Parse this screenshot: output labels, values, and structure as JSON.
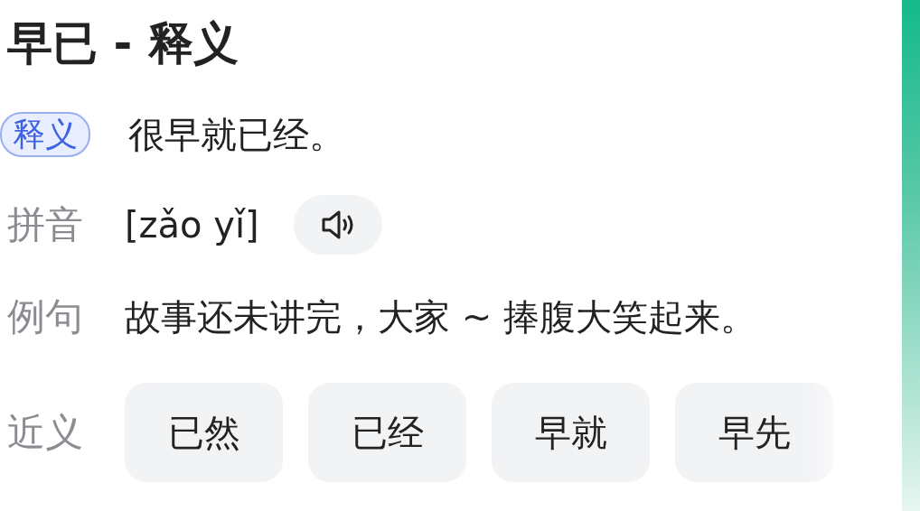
{
  "title": "早已 - 释义",
  "rows": [
    {
      "kind": "badge",
      "label": "释义",
      "text": "很早就已经。"
    },
    {
      "kind": "pinyin",
      "label": "拼音",
      "text": "[zǎo yǐ]"
    },
    {
      "kind": "plain",
      "label": "例句",
      "text": "故事还未讲完，大家 ~ 捧腹大笑起来。"
    },
    {
      "kind": "chips",
      "label": "近义",
      "chips": [
        "已然",
        "已经",
        "早就",
        "早先"
      ]
    }
  ]
}
